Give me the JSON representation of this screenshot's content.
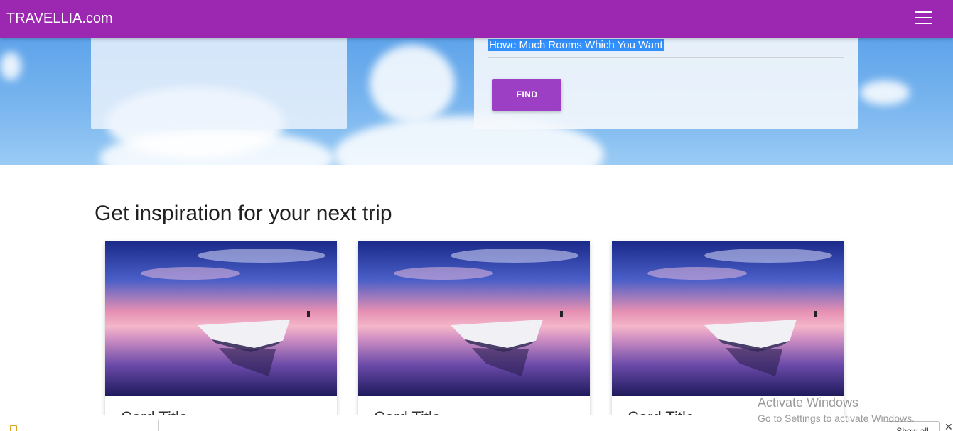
{
  "navbar": {
    "brand": "TRAVELLIA.com",
    "menu_icon": "hamburger-menu-icon"
  },
  "search": {
    "rooms_value": "Howe Much Rooms Which You Want",
    "find_label": "FIND"
  },
  "inspiration": {
    "title": "Get inspiration for your next trip",
    "cards": [
      {
        "title": "Card Title"
      },
      {
        "title": "Card Title"
      },
      {
        "title": "Card Title"
      }
    ]
  },
  "watermark": {
    "title": "Activate Windows",
    "subtitle": "Go to Settings to activate Windows."
  },
  "download_bar": {
    "file_label": "",
    "show_all_label": "Show all",
    "close_icon": "close-icon",
    "file_icon": "document-icon"
  },
  "colors": {
    "brand": "#9c27b0",
    "button": "#9c3fc4",
    "selection": "#3390ff"
  }
}
